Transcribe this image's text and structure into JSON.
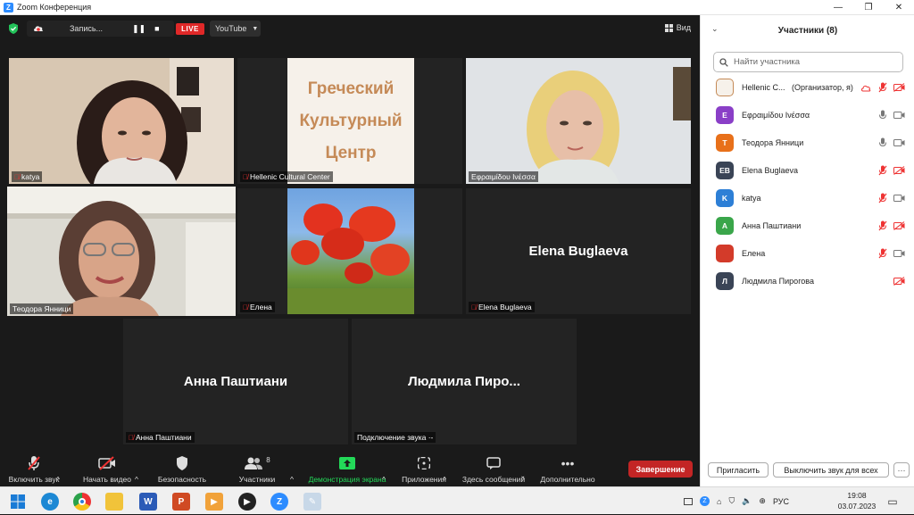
{
  "window": {
    "title": "Zoom Конференция",
    "minimize": "—",
    "maximize": "❐",
    "close": "✕"
  },
  "topbar": {
    "recording_label": "Запись...",
    "pause_icon": "❚❚",
    "stop_icon": "■",
    "live_label": "LIVE",
    "stream_target": "YouTube",
    "view_label": "Вид"
  },
  "tiles": [
    {
      "name": "katya",
      "muted": true
    },
    {
      "name": "Hellenic Cultural Center",
      "muted": true,
      "logo_lines": [
        "Греческий",
        "Культурный",
        "Центр"
      ]
    },
    {
      "name": "Εφραιμίδου Ινέσσα",
      "muted": false
    },
    {
      "name": "Теодора Янници",
      "muted": false,
      "active": true
    },
    {
      "name": "Елена",
      "muted": true
    },
    {
      "name": "Elena Buglaeva",
      "muted": true,
      "display_name": "Elena Buglaeva"
    },
    {
      "name": "Анна Паштиани",
      "muted": true,
      "display_name": "Анна Паштиани"
    },
    {
      "name": "Подключение звука ·-",
      "muted": false,
      "display_name": "Людмила  Пиро..."
    }
  ],
  "toolbar": {
    "audio": "Включить звук",
    "video": "Начать видео",
    "security": "Безопасность",
    "participants": "Участники",
    "participants_count": "8",
    "share": "Демонстрация экрана",
    "apps": "Приложения",
    "chat": "Здесь сообщений",
    "more": "Дополнительно",
    "end": "Завершение"
  },
  "panel": {
    "title": "Участники (8)",
    "search_placeholder": "Найти участника",
    "participants": [
      {
        "initials": "",
        "name": "Hellenic C...",
        "role": "(Организатор, я)",
        "avatar_color": "#f6f1ea",
        "mic": "muted",
        "video": "off",
        "extra": "cloud"
      },
      {
        "initials": "E",
        "name": "Εφραιμίδου Ινέσσα",
        "role": "",
        "avatar_color": "#8a3fc7",
        "mic": "on",
        "video": "on"
      },
      {
        "initials": "T",
        "name": "Теодора Янници",
        "role": "",
        "avatar_color": "#e8701a",
        "mic": "on",
        "video": "on"
      },
      {
        "initials": "EB",
        "name": "Elena Buglaeva",
        "role": "",
        "avatar_color": "#3a4456",
        "mic": "muted",
        "video": "off"
      },
      {
        "initials": "K",
        "name": "katya",
        "role": "",
        "avatar_color": "#2d7fd6",
        "mic": "muted",
        "video": "on"
      },
      {
        "initials": "A",
        "name": "Анна Паштиани",
        "role": "",
        "avatar_color": "#3aa64a",
        "mic": "muted",
        "video": "off"
      },
      {
        "initials": "",
        "name": "Елена",
        "role": "",
        "avatar_color": "#d33b2a",
        "mic": "muted",
        "video": "on"
      },
      {
        "initials": "Л",
        "name": "Людмила Пирогова",
        "role": "",
        "avatar_color": "#3a4456",
        "mic": "none",
        "video": "off"
      }
    ],
    "invite": "Пригласить",
    "mute_all": "Выключить звук для всех",
    "more": "···"
  },
  "taskbar": {
    "apps": [
      "windows",
      "edge",
      "chrome",
      "explorer",
      "word",
      "powerpoint",
      "media",
      "player",
      "zoom",
      "paint"
    ],
    "language": "РУС",
    "time": "19:08",
    "date": "03.07.2023"
  },
  "colors": {
    "accent": "#2d8cff",
    "live": "#e02828",
    "end": "#c32525",
    "share": "#23d959",
    "active_speaker": "#c9e86a"
  }
}
